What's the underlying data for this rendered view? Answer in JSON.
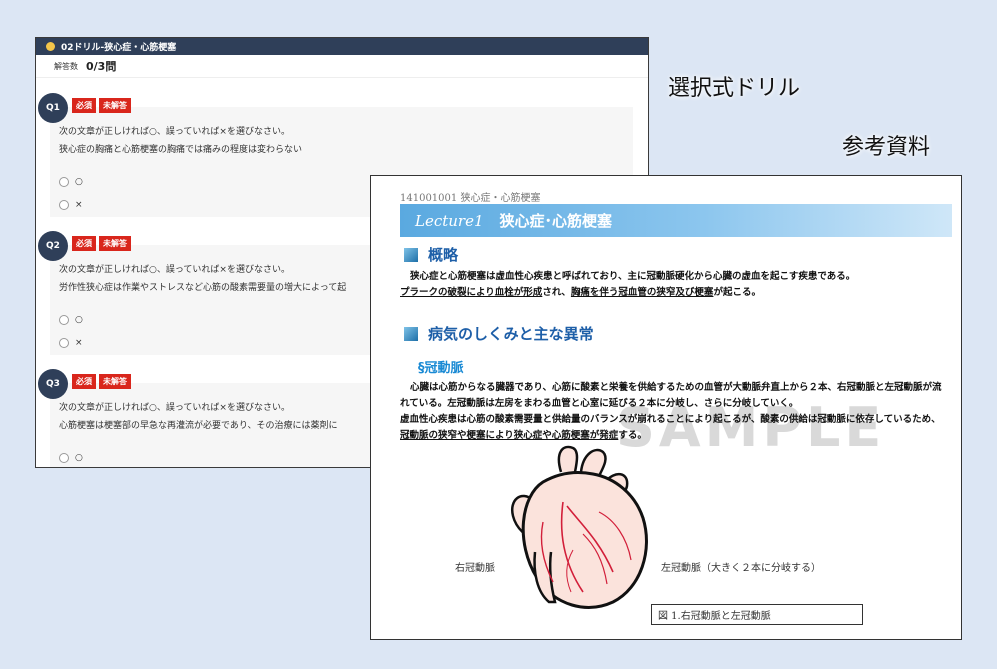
{
  "drill": {
    "title": "02ドリル-狭心症・心筋梗塞",
    "answered_label": "解答数",
    "answered_value": "0/3問",
    "badge_required": "必須",
    "badge_unanswered": "未解答",
    "questions": [
      {
        "num": "Q1",
        "line1": "次の文章が正しければ○、誤っていれば×を選びなさい。",
        "line2": "狭心症の胸痛と心筋梗塞の胸痛では痛みの程度は変わらない",
        "opt1": "○",
        "opt2": "×"
      },
      {
        "num": "Q2",
        "line1": "次の文章が正しければ○、誤っていれば×を選びなさい。",
        "line2": "労作性狭心症は作業やストレスなど心筋の酸素需要量の増大によって起",
        "opt1": "○",
        "opt2": "×"
      },
      {
        "num": "Q3",
        "line1": "次の文章が正しければ○、誤っていれば×を選びなさい。",
        "line2": "心筋梗塞は梗塞部の早急な再灌流が必要であり、その治療には薬剤に",
        "opt1": "○"
      }
    ]
  },
  "labels": {
    "drill_caption": "選択式ドリル",
    "reference_caption": "参考資料"
  },
  "reference": {
    "code": "141001001 狭心症・心筋梗塞",
    "lecture_label": "Lecture1",
    "lecture_title": "狭心症･心筋梗塞",
    "section1": "概略",
    "overview_1": "狭心症と心筋梗塞は虚血性心疾患と呼ばれており、主に冠動脈硬化から心臓の虚血を起こす疾患である。",
    "overview_2a": "プラークの破裂により血栓が形成",
    "overview_2b": "され、",
    "overview_2c": "胸痛を伴う冠血管の狭窄及び梗塞",
    "overview_2d": "が起こる。",
    "section2": "病気のしくみと主な異常",
    "subsection": "§冠動脈",
    "body_1": "心臓は心筋からなる臓器であり、心筋に酸素と栄養を供給するための血管が大動脈弁直上から２本、右冠動脈と左冠動脈が流れている。左冠動脈は左房をまわる血管と心室に延びる２本に分岐し、さらに分岐していく。",
    "body_2a": "虚血性心疾患は心筋の酸素需要量と供給量のバランスが崩れることにより起こるが、酸素の供給は冠動脈に依存しているため、",
    "body_2b": "冠動脈の狭窄や梗塞により狭心症や心筋梗塞が発症",
    "body_2c": "する。",
    "watermark": "SAMPLE",
    "right_coronary": "右冠動脈",
    "left_coronary": "左冠動脈（大きく２本に分岐する）",
    "figure_caption": "図 1.右冠動脈と左冠動脈"
  },
  "colors": {
    "header_navy": "#2f3f59",
    "badge_red": "#d9261c",
    "background": "#dce6f4",
    "section_blue": "#1e5fa8"
  }
}
